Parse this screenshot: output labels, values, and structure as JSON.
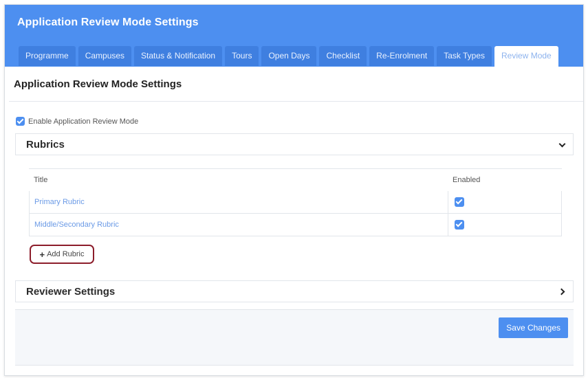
{
  "header": {
    "title": "Application Review Mode Settings",
    "tabs": [
      {
        "label": "Programme"
      },
      {
        "label": "Campuses"
      },
      {
        "label": "Status & Notification"
      },
      {
        "label": "Tours"
      },
      {
        "label": "Open Days"
      },
      {
        "label": "Checklist"
      },
      {
        "label": "Re-Enrolment"
      },
      {
        "label": "Task Types"
      },
      {
        "label": "Review Mode",
        "active": true
      }
    ]
  },
  "section": {
    "title": "Application Review Mode Settings"
  },
  "enable": {
    "label": "Enable Application Review Mode",
    "checked": true
  },
  "rubrics": {
    "title": "Rubrics",
    "expanded": true,
    "columns": {
      "title": "Title",
      "enabled": "Enabled"
    },
    "rows": [
      {
        "title": "Primary Rubric",
        "enabled": true
      },
      {
        "title": "Middle/Secondary Rubric",
        "enabled": true
      }
    ],
    "add_label": "Add Rubric"
  },
  "reviewer": {
    "title": "Reviewer Settings",
    "expanded": false
  },
  "footer": {
    "save_label": "Save Changes"
  },
  "colors": {
    "accent": "#4d8ff0",
    "link": "#6a9ae6",
    "highlight_ring": "#8c1c2a"
  }
}
